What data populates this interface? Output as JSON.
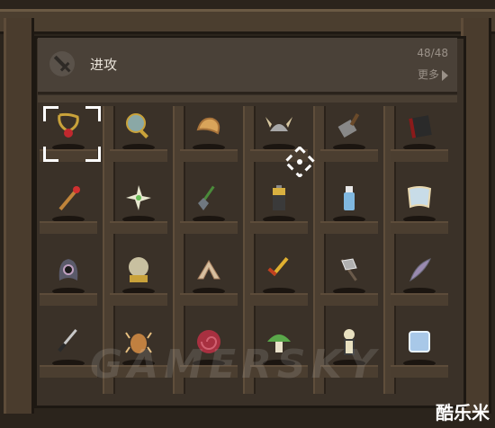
{
  "header": {
    "title": "进攻",
    "count": "48/48",
    "more_label": "更多",
    "icon": "sword-icon"
  },
  "items": [
    {
      "name": "amulet-icon",
      "color": "#c9a23a",
      "accent": "#c0282e"
    },
    {
      "name": "mirror-icon",
      "color": "#8aa8a6",
      "accent": "#c9a23a"
    },
    {
      "name": "fortune-cookie-icon",
      "color": "#d9a45a",
      "accent": "#a8733a"
    },
    {
      "name": "viking-helmet-icon",
      "color": "#a8a8a8",
      "accent": "#d8c8a0"
    },
    {
      "name": "shovel-head-icon",
      "color": "#888888",
      "accent": "#6a4a2a"
    },
    {
      "name": "book-icon",
      "color": "#2a2a2a",
      "accent": "#8a1a1a"
    },
    {
      "name": "matchstick-icon",
      "color": "#c0843a",
      "accent": "#d03030"
    },
    {
      "name": "pinwheel-icon",
      "color": "#e8e8d0",
      "accent": "#6abf5a"
    },
    {
      "name": "shovel-icon",
      "color": "#707880",
      "accent": "#4a8a3a"
    },
    {
      "name": "battery-icon",
      "color": "#3a3a3a",
      "accent": "#d8b040"
    },
    {
      "name": "water-bottle-icon",
      "color": "#80b8e0",
      "accent": "#e8e8e8"
    },
    {
      "name": "map-scroll-icon",
      "color": "#c8dce8",
      "accent": "#e8d8b0"
    },
    {
      "name": "hood-icon",
      "color": "#5a5a6a",
      "accent": "#c0a0c0"
    },
    {
      "name": "crystal-ball-icon",
      "color": "#c8c0a0",
      "accent": "#c9a23a"
    },
    {
      "name": "boomerang-icon",
      "color": "#d8c0a0",
      "accent": "#a88060"
    },
    {
      "name": "golden-dagger-icon",
      "color": "#e0b030",
      "accent": "#c04020"
    },
    {
      "name": "double-axe-icon",
      "color": "#b0b0b0",
      "accent": "#e8e8e8"
    },
    {
      "name": "quill-icon",
      "color": "#9a8ab0",
      "accent": "#6a6a7a"
    },
    {
      "name": "knife-icon",
      "color": "#c8c8c8",
      "accent": "#2a2a2a"
    },
    {
      "name": "bug-icon",
      "color": "#c08040",
      "accent": "#e8c080"
    },
    {
      "name": "shell-icon",
      "color": "#a83040",
      "accent": "#d06070"
    },
    {
      "name": "mushroom-icon",
      "color": "#5aa84a",
      "accent": "#e8e0c8"
    },
    {
      "name": "skeleton-icon",
      "color": "#e8e0c0",
      "accent": "#3a3a3a"
    },
    {
      "name": "ice-cube-icon",
      "color": "#a8c8e8",
      "accent": "#e8f4ff"
    }
  ],
  "watermark": "GAMERSKY",
  "logo": "酷乐米"
}
